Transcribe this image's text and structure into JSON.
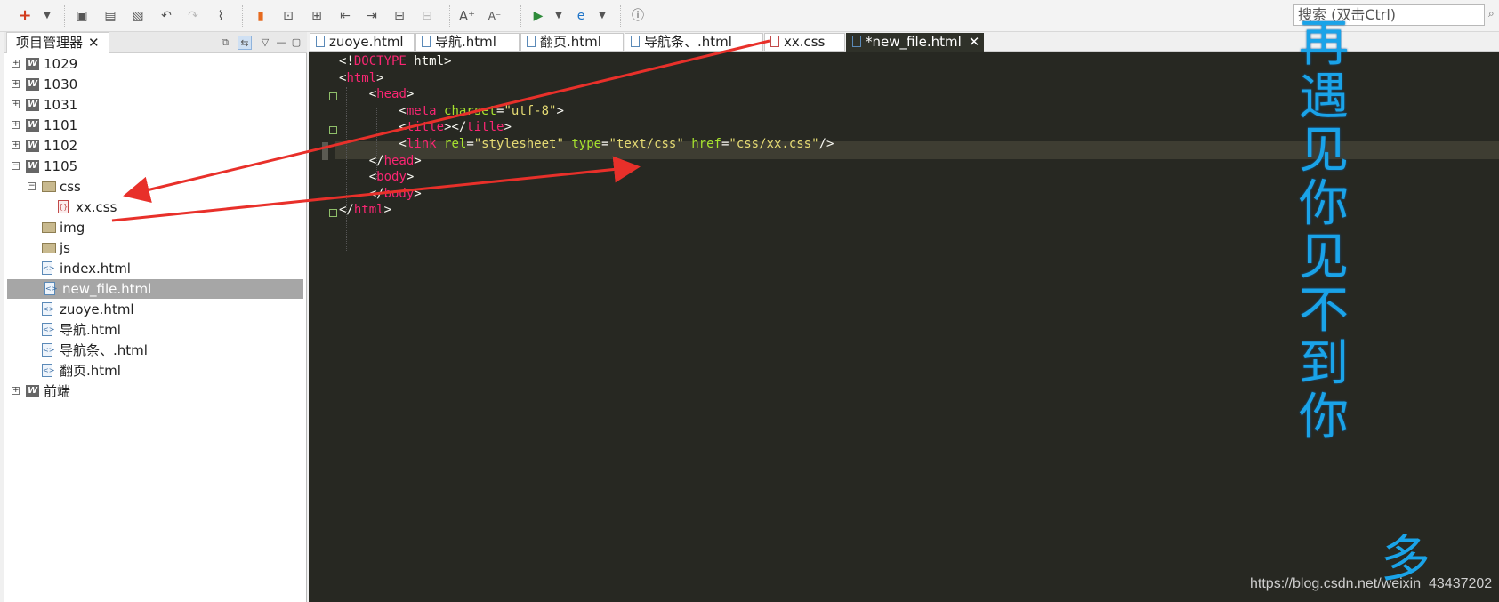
{
  "toolbar": {
    "icons": [
      "add-icon",
      "dropdown-icon",
      "save-icon",
      "save-all-icon",
      "revert-icon",
      "undo-icon",
      "redo-icon",
      "format-icon",
      "bookmark-icon",
      "insert-icon",
      "insert-2-icon",
      "indent-icon",
      "outdent-icon",
      "comment-icon",
      "uncomment-icon",
      "font-increase-icon",
      "font-decrease-icon",
      "run-icon",
      "dropdown-icon",
      "browser-icon",
      "dropdown-icon",
      "info-icon"
    ],
    "search_placeholder": "搜索 (双击Ctrl)"
  },
  "left_panel": {
    "tab_label": "项目管理器",
    "tree": [
      {
        "label": "1029",
        "type": "project",
        "expanded": false,
        "depth": 0
      },
      {
        "label": "1030",
        "type": "project",
        "expanded": false,
        "depth": 0
      },
      {
        "label": "1031",
        "type": "project",
        "expanded": false,
        "depth": 0
      },
      {
        "label": "1101",
        "type": "project",
        "expanded": false,
        "depth": 0
      },
      {
        "label": "1102",
        "type": "project",
        "expanded": false,
        "depth": 0
      },
      {
        "label": "1105",
        "type": "project",
        "expanded": true,
        "depth": 0
      },
      {
        "label": "css",
        "type": "folder",
        "expanded": true,
        "depth": 1
      },
      {
        "label": "xx.css",
        "type": "css-file",
        "depth": 2
      },
      {
        "label": "img",
        "type": "folder",
        "depth": 1
      },
      {
        "label": "js",
        "type": "folder",
        "depth": 1
      },
      {
        "label": "index.html",
        "type": "html-file",
        "depth": 1
      },
      {
        "label": "new_file.html",
        "type": "html-file",
        "depth": 1,
        "selected": true
      },
      {
        "label": "zuoye.html",
        "type": "html-file",
        "depth": 1
      },
      {
        "label": "导航.html",
        "type": "html-file",
        "depth": 1
      },
      {
        "label": "导航条、.html",
        "type": "html-file",
        "depth": 1
      },
      {
        "label": "翻页.html",
        "type": "html-file",
        "depth": 1
      },
      {
        "label": "前端",
        "type": "project",
        "expanded": false,
        "depth": 0
      }
    ]
  },
  "editor": {
    "tabs": [
      {
        "label": "zuoye.html",
        "type": "html"
      },
      {
        "label": "导航.html",
        "type": "html"
      },
      {
        "label": "翻页.html",
        "type": "html"
      },
      {
        "label": "导航条、.html",
        "type": "html"
      },
      {
        "label": "xx.css",
        "type": "css"
      },
      {
        "label": "*new_file.html",
        "type": "html",
        "active": true
      }
    ],
    "code_lines": [
      [
        [
          "p",
          "<!"
        ],
        [
          "tag",
          "DOCTYPE"
        ],
        [
          "p",
          " html>"
        ]
      ],
      [
        [
          "p",
          "<"
        ],
        [
          "tag",
          "html"
        ],
        [
          "p",
          ">"
        ]
      ],
      [
        [
          "p",
          "    <"
        ],
        [
          "tag",
          "head"
        ],
        [
          "p",
          ">"
        ]
      ],
      [
        [
          "p",
          "        <"
        ],
        [
          "tag",
          "meta"
        ],
        [
          "p",
          " "
        ],
        [
          "attr",
          "charset"
        ],
        [
          "p",
          "="
        ],
        [
          "str",
          "\"utf-8\""
        ],
        [
          "p",
          ">"
        ]
      ],
      [
        [
          "p",
          "        <"
        ],
        [
          "tag",
          "title"
        ],
        [
          "p",
          "></"
        ],
        [
          "tag",
          "title"
        ],
        [
          "p",
          ">"
        ]
      ],
      [
        [
          "p",
          "        <"
        ],
        [
          "tag",
          "link"
        ],
        [
          "p",
          " "
        ],
        [
          "attr",
          "rel"
        ],
        [
          "p",
          "="
        ],
        [
          "str",
          "\"stylesheet\""
        ],
        [
          "p",
          " "
        ],
        [
          "attr",
          "type"
        ],
        [
          "p",
          "="
        ],
        [
          "str",
          "\"text/css\""
        ],
        [
          "p",
          " "
        ],
        [
          "attr",
          "href"
        ],
        [
          "p",
          "="
        ],
        [
          "str",
          "\"css/xx.css\""
        ],
        [
          "p",
          "/>"
        ]
      ],
      [
        [
          "p",
          "    </"
        ],
        [
          "tag",
          "head"
        ],
        [
          "p",
          ">"
        ]
      ],
      [
        [
          "p",
          "    <"
        ],
        [
          "tag",
          "body"
        ],
        [
          "p",
          ">"
        ]
      ],
      [
        [
          "p",
          "    </"
        ],
        [
          "tag",
          "body"
        ],
        [
          "p",
          ">"
        ]
      ],
      [
        [
          "p",
          "</"
        ],
        [
          "tag",
          "html"
        ],
        [
          "p",
          ">"
        ]
      ]
    ]
  },
  "overlay": {
    "vertical_text": "再遇见你见不到你",
    "vertical_text_2": "多",
    "watermark": "https://blog.csdn.net/weixin_43437202"
  },
  "colors": {
    "editor_bg": "#272822",
    "tag": "#f92672",
    "attr": "#a6e22e",
    "string": "#e6db74",
    "arrow": "#e8302a",
    "overlay_text": "#1aa3e8"
  }
}
